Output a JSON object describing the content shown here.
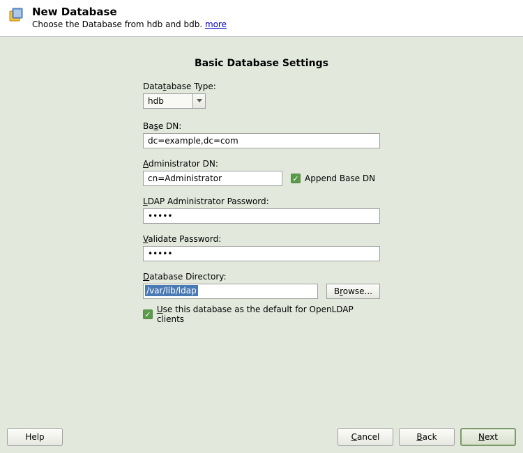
{
  "header": {
    "title": "New Database",
    "subtitle": "Choose the Database from hdb and bdb.",
    "more_label": "more"
  },
  "section_title": "Basic Database Settings",
  "form": {
    "db_type": {
      "label_pre": "Data",
      "label_u": "t",
      "label_post": "abase Type:",
      "value": "hdb"
    },
    "base_dn": {
      "label_pre": "Ba",
      "label_u": "s",
      "label_post": "e DN:",
      "value": "dc=example,dc=com"
    },
    "admin_dn": {
      "label_u": "A",
      "label_post": "dministrator DN:",
      "value": "cn=Administrator"
    },
    "append_base_dn_label": "Append Base DN",
    "append_base_dn_checked": true,
    "ldap_pw": {
      "label_u": "L",
      "label_post": "DAP Administrator Password:",
      "value": "•••••"
    },
    "validate_pw": {
      "label_u": "V",
      "label_post": "alidate Password:",
      "value": "•••••"
    },
    "db_dir": {
      "label_u": "D",
      "label_post": "atabase Directory:",
      "value": "/var/lib/ldap",
      "browse_pre": "B",
      "browse_u": "r",
      "browse_post": "owse..."
    },
    "use_default": {
      "checked": true,
      "label_u": "U",
      "label_post": "se this database as the default for OpenLDAP clients"
    }
  },
  "footer": {
    "help": "Help",
    "cancel_u": "C",
    "cancel_post": "ancel",
    "back_u": "B",
    "back_post": "ack",
    "next_u": "N",
    "next_post": "ext"
  }
}
